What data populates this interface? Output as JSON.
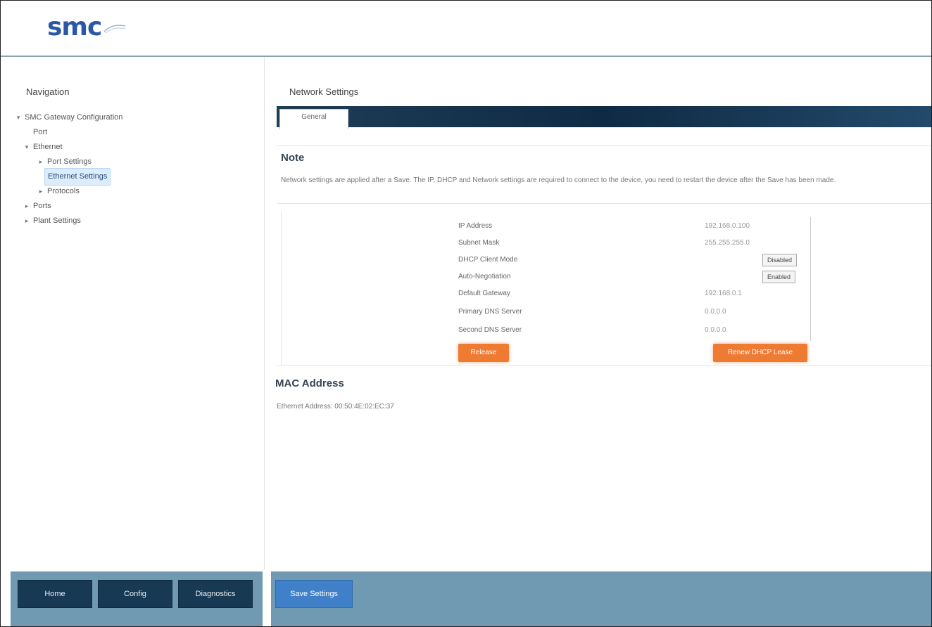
{
  "header": {
    "logo_text": "smc"
  },
  "nav": {
    "title": "Navigation",
    "items": [
      {
        "label": "SMC Gateway Configuration"
      },
      {
        "label": "Port"
      },
      {
        "label": "Ethernet"
      },
      {
        "label": "Port Settings"
      },
      {
        "label": "Ethernet Settings"
      },
      {
        "label": "Protocols"
      },
      {
        "label": "Ports"
      },
      {
        "label": "Plant Settings"
      }
    ]
  },
  "main": {
    "title": "Network Settings",
    "tab_label": "General",
    "note_heading": "Note",
    "note_text": "Network settings are applied after a Save. The IP, DHCP and Network settings are required to connect to the device, you need to restart the device after the Save has been made.",
    "form": {
      "rows": [
        {
          "label": "IP Address",
          "value": "192.168.0.100"
        },
        {
          "label": "Subnet Mask",
          "value": "255.255.255.0"
        },
        {
          "label": "DHCP Client Mode",
          "button": "Disabled"
        },
        {
          "label": "Auto-Negotiation",
          "button": "Enabled"
        },
        {
          "label": "Default Gateway",
          "value": "192.168.0.1"
        },
        {
          "label": "Primary DNS Server",
          "value": "0.0.0.0"
        },
        {
          "label": "Second DNS Server",
          "value": "0.0.0.0"
        }
      ],
      "left_button": "Release",
      "right_button": "Renew DHCP Lease"
    },
    "mac_heading": "MAC Address",
    "mac_text": "Ethernet Address: 00:50:4E:02:EC:37"
  },
  "footer": {
    "left_buttons": [
      "Home",
      "Config",
      "Diagnostics"
    ],
    "save_button": "Save Settings"
  }
}
